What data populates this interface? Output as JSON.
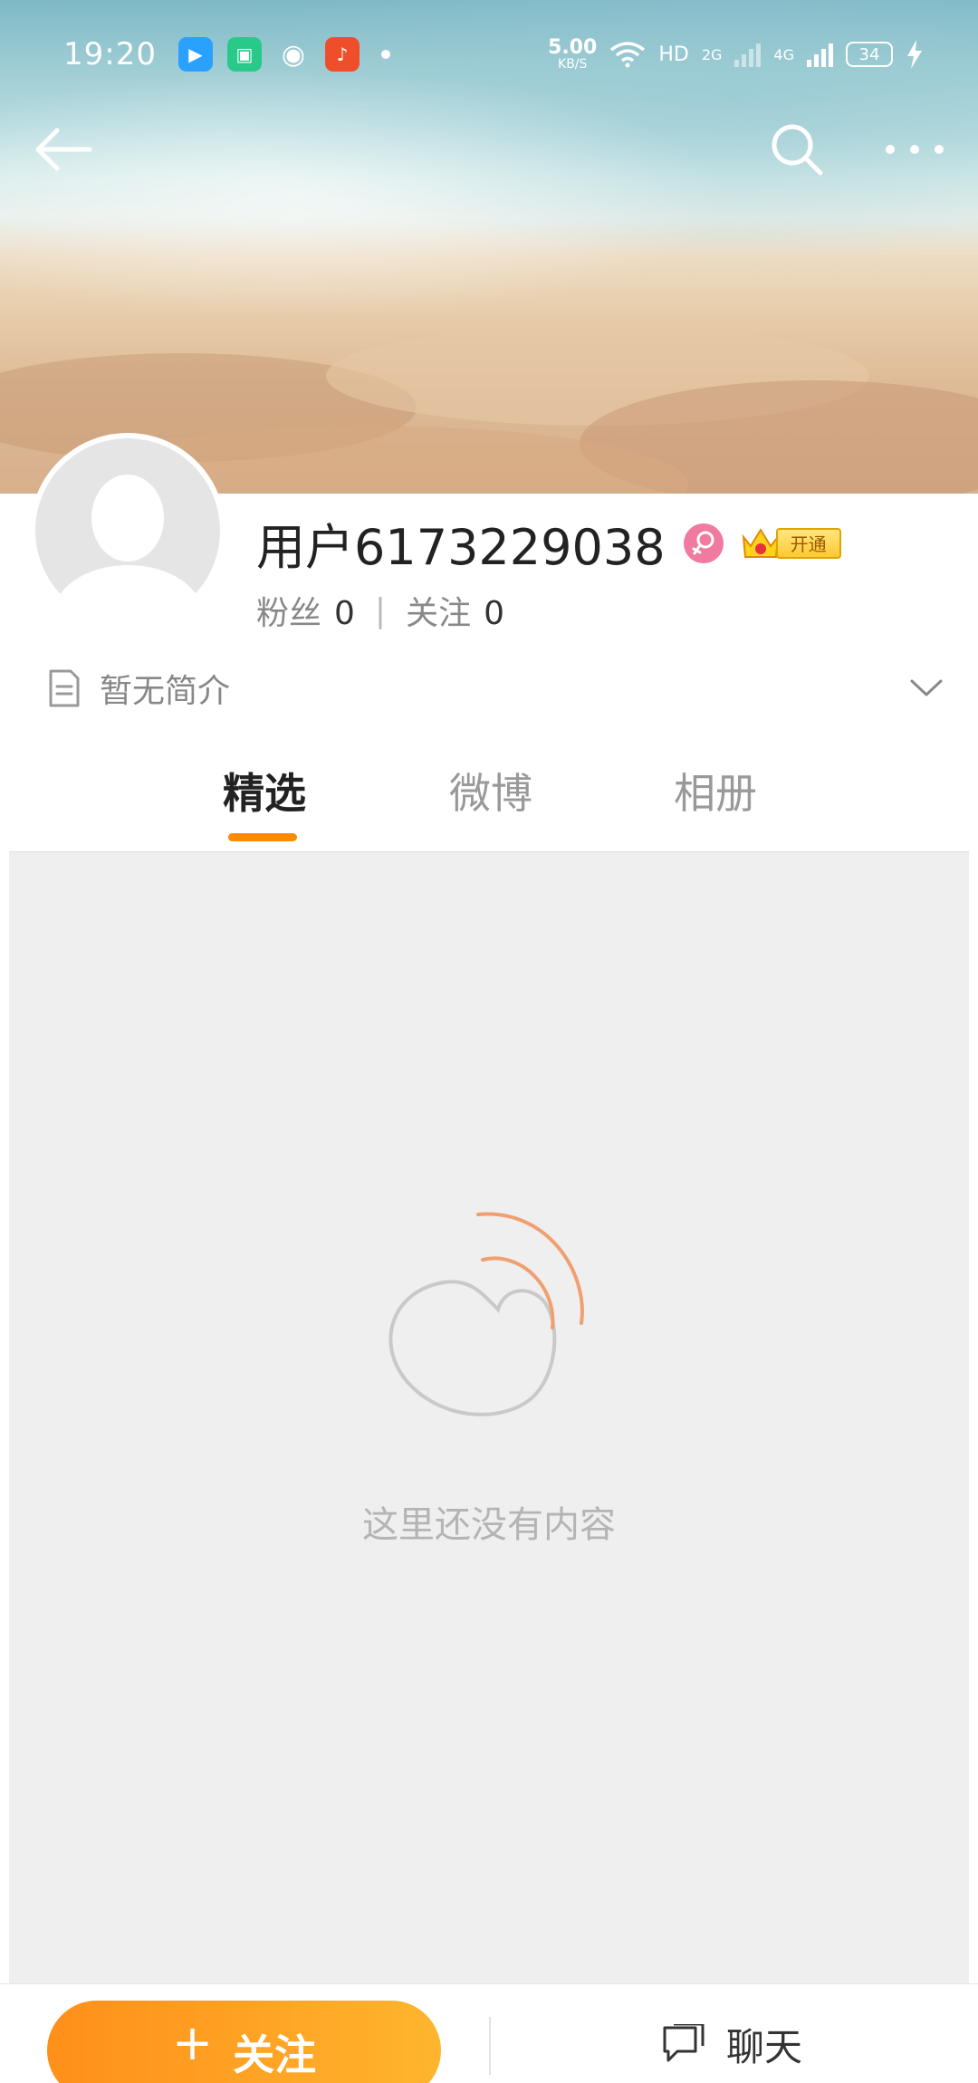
{
  "status_bar": {
    "time": "19:20",
    "net_speed_value": "5.00",
    "net_speed_unit": "KB/S",
    "hd_label": "HD",
    "sim1_label": "2G",
    "sim2_label": "4G",
    "battery": "34"
  },
  "profile": {
    "username": "用户6173229038",
    "vip_label": "开通",
    "followers_label": "粉丝",
    "followers_count": "0",
    "following_label": "关注",
    "following_count": "0",
    "intro": "暂无简介"
  },
  "tabs": [
    {
      "label": "精选",
      "active": true
    },
    {
      "label": "微博",
      "active": false
    },
    {
      "label": "相册",
      "active": false
    }
  ],
  "content": {
    "empty_text": "这里还没有内容"
  },
  "bottom_bar": {
    "follow_plus": "+",
    "follow_label": "关注",
    "chat_label": "聊天"
  },
  "colors": {
    "accent": "#ff8a00",
    "follow_gradient_start": "#ff8f1a",
    "follow_gradient_end": "#ffb52e",
    "content_bg": "#efefef",
    "gender_badge": "#f07aa0"
  },
  "icons": {
    "back": "arrow-left-icon",
    "search": "search-icon",
    "more": "more-horizontal-icon",
    "intro": "document-icon",
    "expand": "chevron-down-icon",
    "empty": "weibo-logo-icon",
    "chat": "chat-bubble-icon",
    "gender": "female-icon",
    "vip": "crown-icon"
  }
}
